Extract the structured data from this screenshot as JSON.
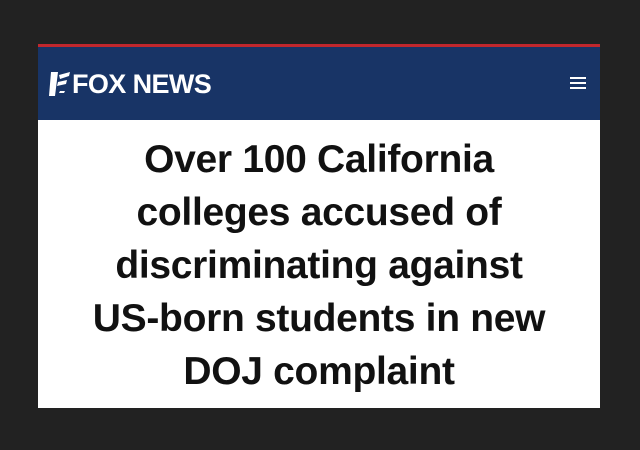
{
  "header": {
    "logo_text": "FOX NEWS",
    "logo_icon": "fox-news-logo-mark",
    "menu_icon": "hamburger-menu-icon"
  },
  "article": {
    "headline_lines": [
      "Over 100 California",
      "colleges accused of",
      "discriminating against",
      "US-born students in new",
      "DOJ complaint"
    ]
  },
  "colors": {
    "page_background": "#222222",
    "header_background": "#183466",
    "accent_stripe": "#c1272d",
    "card_background": "#ffffff",
    "headline_text": "#111111"
  }
}
